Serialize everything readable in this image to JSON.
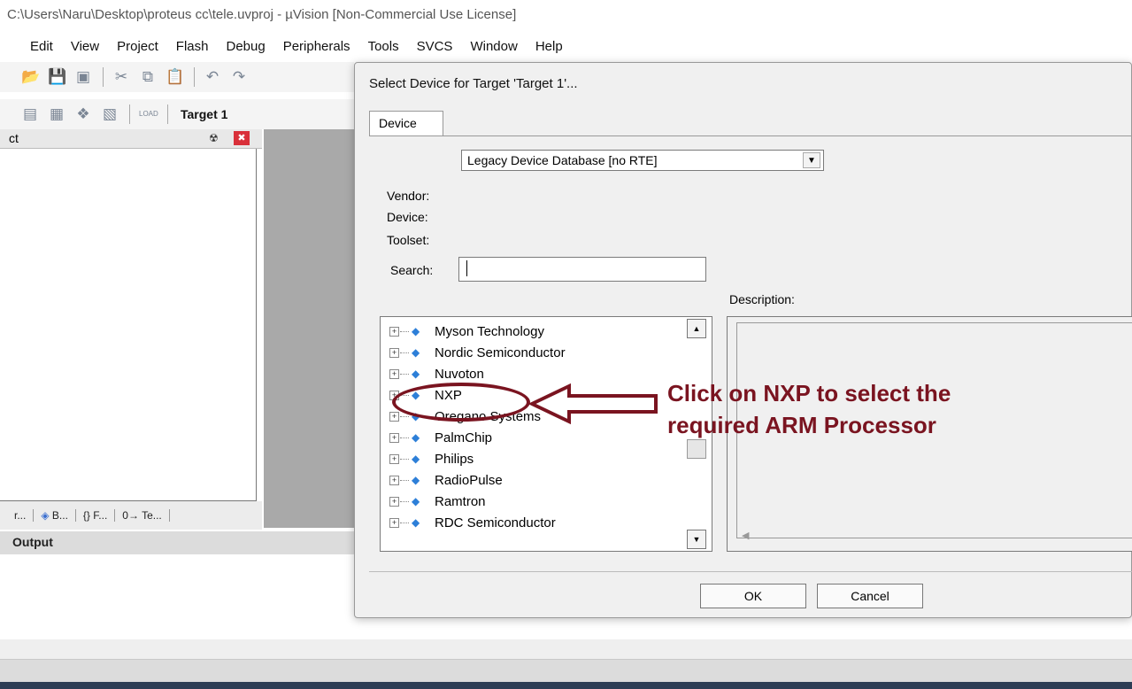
{
  "window": {
    "title": "C:\\Users\\Naru\\Desktop\\proteus cc\\tele.uvproj - µVision  [Non-Commercial Use License]"
  },
  "menu": [
    "Edit",
    "View",
    "Project",
    "Flash",
    "Debug",
    "Peripherals",
    "Tools",
    "SVCS",
    "Window",
    "Help"
  ],
  "toolbar": {
    "target": "Target 1"
  },
  "project_pane": {
    "title": "ct",
    "tabs": [
      "r...",
      "B...",
      "F...",
      "Te..."
    ]
  },
  "output": {
    "label": "Output"
  },
  "dialog": {
    "title": "Select Device for Target 'Target 1'...",
    "tab": "Device",
    "database": "Legacy Device Database [no RTE]",
    "labels": {
      "vendor": "Vendor:",
      "device": "Device:",
      "toolset": "Toolset:",
      "search": "Search:",
      "description": "Description:"
    },
    "search_value": "",
    "vendors": [
      "Myson Technology",
      "Nordic Semiconductor",
      "Nuvoton",
      "NXP",
      "Oregano Systems",
      "PalmChip",
      "Philips",
      "RadioPulse",
      "Ramtron",
      "RDC Semiconductor"
    ],
    "ok": "OK",
    "cancel": "Cancel"
  },
  "annotation": {
    "line1": "Click on NXP to select the",
    "line2": "required ARM Processor",
    "color": "#7a1420"
  },
  "icons": {
    "expander": "plus-box-icon",
    "vendor": "diamond-chip-icon"
  }
}
